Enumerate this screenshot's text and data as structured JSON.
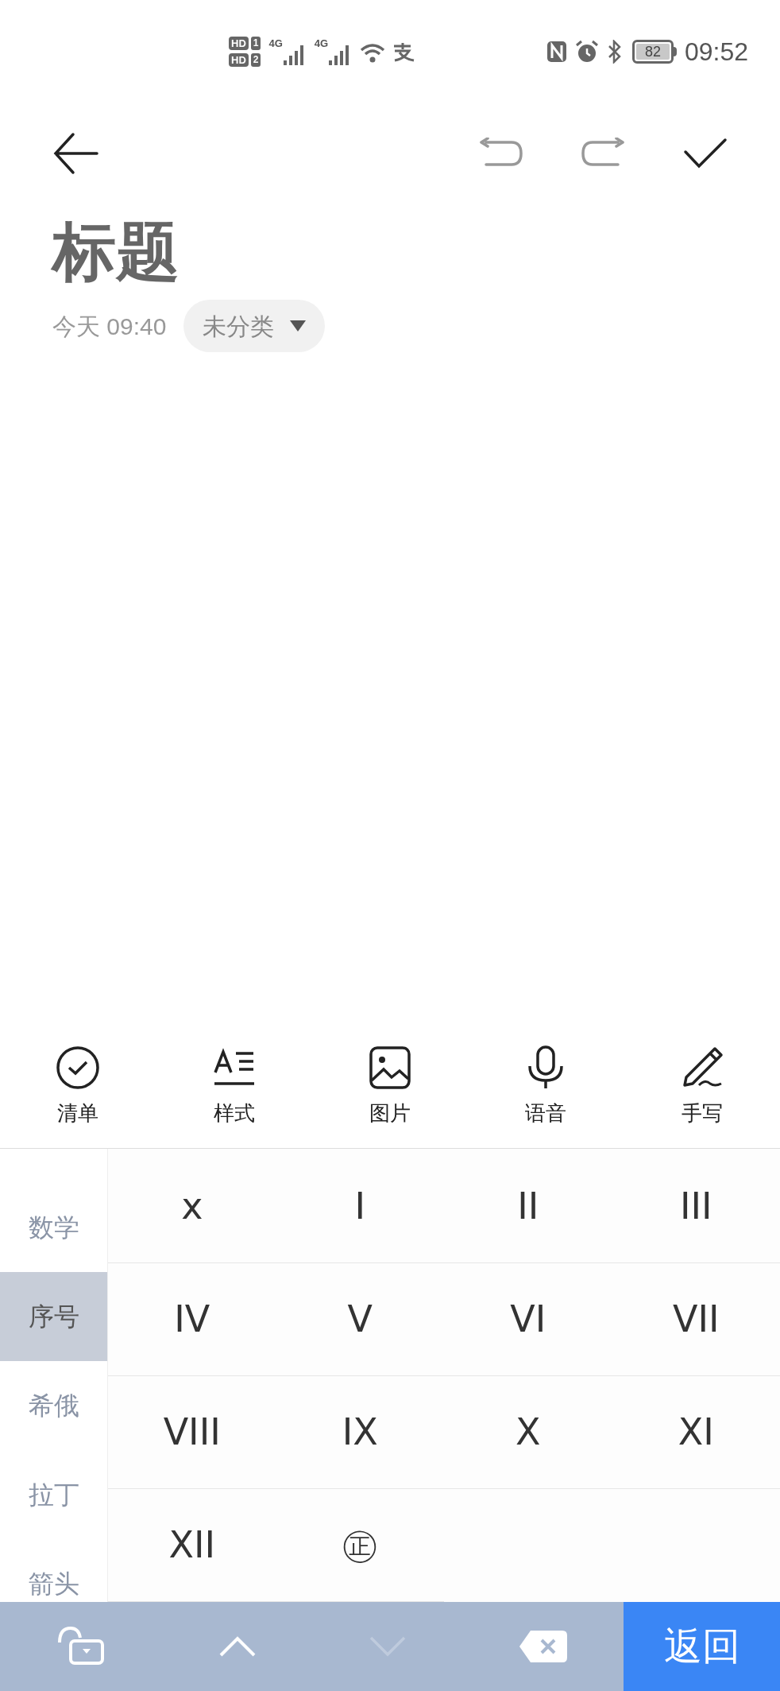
{
  "status_bar": {
    "sim_badges": [
      {
        "label": "HD",
        "slot": "1"
      },
      {
        "label": "HD",
        "slot": "2"
      }
    ],
    "networks": [
      "4G",
      "4G"
    ],
    "battery": "82",
    "time": "09:52"
  },
  "note": {
    "title": "标题",
    "date": "今天 09:40",
    "category": "未分类"
  },
  "toolbar": [
    {
      "kind": "checklist",
      "label": "清单"
    },
    {
      "kind": "style",
      "label": "样式"
    },
    {
      "kind": "image",
      "label": "图片"
    },
    {
      "kind": "voice",
      "label": "语音"
    },
    {
      "kind": "handwrite",
      "label": "手写"
    }
  ],
  "keyboard": {
    "categories": [
      {
        "label": "数学",
        "selected": false
      },
      {
        "label": "序号",
        "selected": true
      },
      {
        "label": "希俄",
        "selected": false
      },
      {
        "label": "拉丁",
        "selected": false
      },
      {
        "label": "箭头",
        "selected": false
      }
    ],
    "symbols": [
      "x",
      "I",
      "II",
      "III",
      "IV",
      "V",
      "VI",
      "VII",
      "VIII",
      "IX",
      "X",
      "XI",
      "XII",
      "㊣"
    ],
    "bottom_bar": {
      "down_disabled": true,
      "return_label": "返回"
    }
  }
}
